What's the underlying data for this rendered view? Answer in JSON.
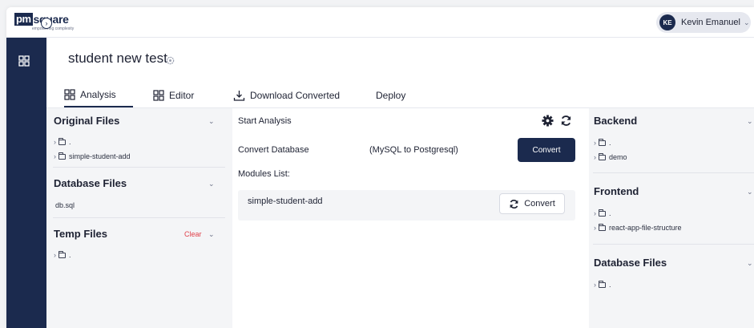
{
  "brand": {
    "logo_pm": "pm",
    "logo_rest": "square",
    "tagline": "empowering complexity"
  },
  "user": {
    "initials": "KE",
    "name": "Kevin Emanuel"
  },
  "project": {
    "title": "student new test"
  },
  "tabs": [
    {
      "label": "Analysis",
      "icon": "grid-icon",
      "active": true
    },
    {
      "label": "Editor",
      "icon": "grid-icon",
      "active": false
    },
    {
      "label": "Download Converted",
      "icon": "download-icon",
      "active": false
    },
    {
      "label": "Deploy",
      "icon": "",
      "active": false
    }
  ],
  "left": {
    "original": {
      "title": "Original Files",
      "items": [
        ".",
        "simple-student-add"
      ]
    },
    "database": {
      "title": "Database Files",
      "items": [
        "db.sql"
      ]
    },
    "temp": {
      "title": "Temp Files",
      "clear_label": "Clear",
      "items": [
        "."
      ]
    }
  },
  "middle": {
    "start_analysis": "Start Analysis",
    "convert_db_label": "Convert Database",
    "convert_db_desc": "(MySQL to Postgresql)",
    "convert_button": "Convert",
    "modules_label": "Modules List:",
    "modules": [
      {
        "name": "simple-student-add",
        "button": "Convert"
      }
    ]
  },
  "right": {
    "backend": {
      "title": "Backend",
      "items": [
        ".",
        "demo"
      ]
    },
    "frontend": {
      "title": "Frontend",
      "items": [
        ".",
        "react-app-file-structure"
      ]
    },
    "database": {
      "title": "Database Files",
      "items": [
        "."
      ]
    }
  },
  "colors": {
    "navy": "#1b2a4e",
    "clear_red": "#e0404a",
    "panel_gray": "#f4f5f7"
  }
}
